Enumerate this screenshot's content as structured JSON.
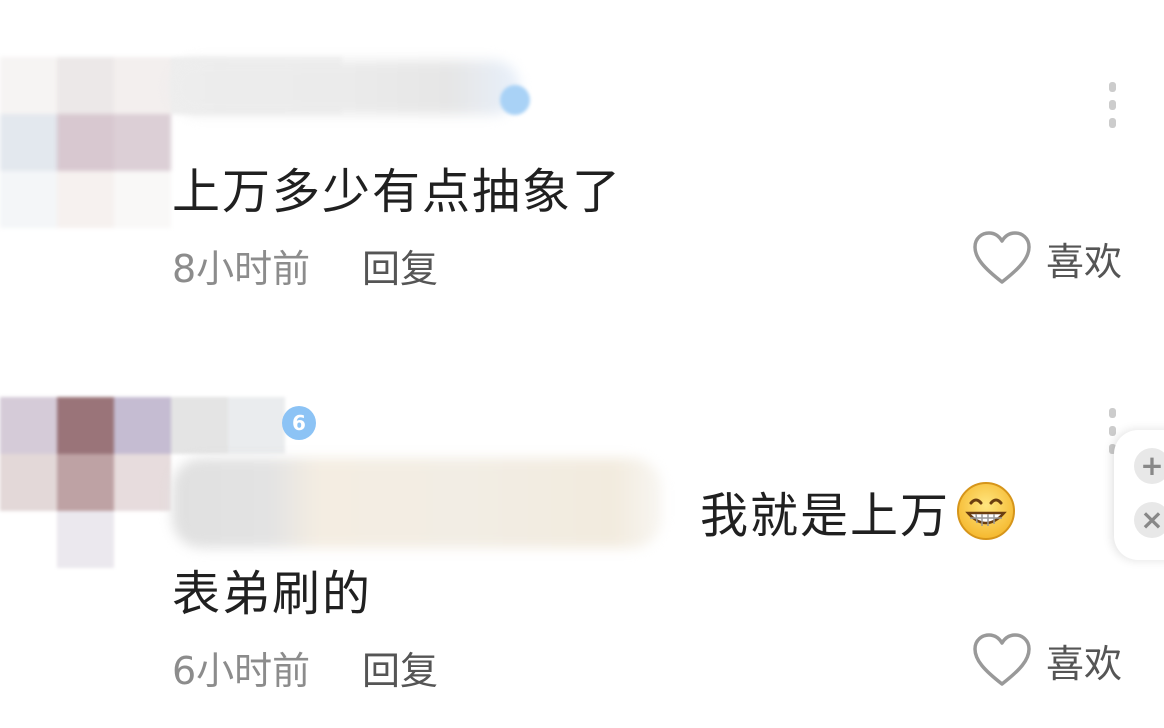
{
  "comments": [
    {
      "content": "上万多少有点抽象了",
      "time": "8小时前",
      "reply_label": "回复",
      "like_label": "喜欢"
    },
    {
      "level_badge": "6",
      "reply_context": "我就是上万",
      "content": "表弟刷的",
      "time": "6小时前",
      "reply_label": "回复",
      "like_label": "喜欢"
    }
  ],
  "floating_panel": {
    "plus_symbol": "+",
    "close_symbol": "×"
  },
  "icons": {
    "like": "heart-outline-icon",
    "more": "vertical-dots-icon",
    "emoji": "grinning-face-icon"
  },
  "colors": {
    "text_primary": "#202020",
    "text_secondary": "#8c8c8c",
    "badge": "#8cc3f5"
  }
}
